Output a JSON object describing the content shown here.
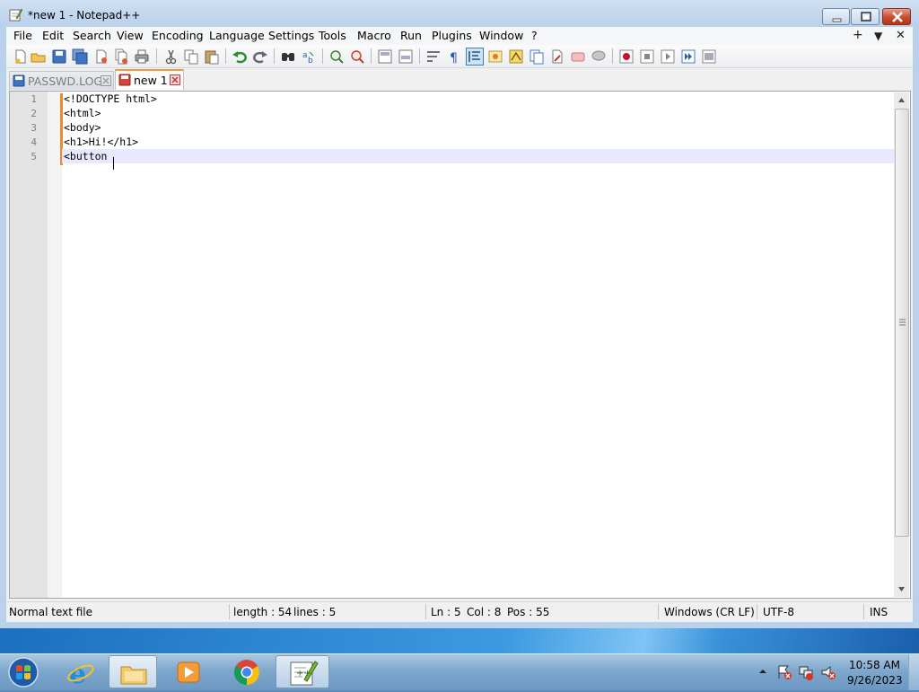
{
  "window": {
    "title": "*new 1 - Notepad++"
  },
  "menu": {
    "items": [
      "File",
      "Edit",
      "Search",
      "View",
      "Encoding",
      "Language",
      "Settings",
      "Tools",
      "Macro",
      "Run",
      "Plugins",
      "Window",
      "?"
    ],
    "right": [
      "+",
      "▼",
      "✕"
    ]
  },
  "tabs": [
    {
      "label": "PASSWD.LOG",
      "active": false
    },
    {
      "label": "new 1",
      "active": true
    }
  ],
  "editor": {
    "lines": [
      "<!DOCTYPE html>",
      "<html>",
      "<body>",
      "<h1>Hi!</h1>",
      "<button"
    ],
    "line_numbers": [
      "1",
      "2",
      "3",
      "4",
      "5"
    ],
    "current_line": 5,
    "change_bar_color": "#ef8a2c"
  },
  "status": {
    "type": "Normal text file",
    "length": "length : 54",
    "lines": "lines : 5",
    "ln": "Ln : 5",
    "col": "Col : 8",
    "pos": "Pos : 55",
    "eol": "Windows (CR LF)",
    "encoding": "UTF-8",
    "mode": "INS"
  },
  "taskbar": {
    "apps": [
      "start-orb",
      "internet-explorer",
      "file-explorer",
      "media-player",
      "chrome",
      "notepad-plus-plus"
    ],
    "time": "10:58 AM",
    "date": "9/26/2023"
  },
  "colors": {
    "tab_accent": "#f29b3e",
    "current_line_bg": "#e8e8ff",
    "close_button": "#c94a2f"
  }
}
